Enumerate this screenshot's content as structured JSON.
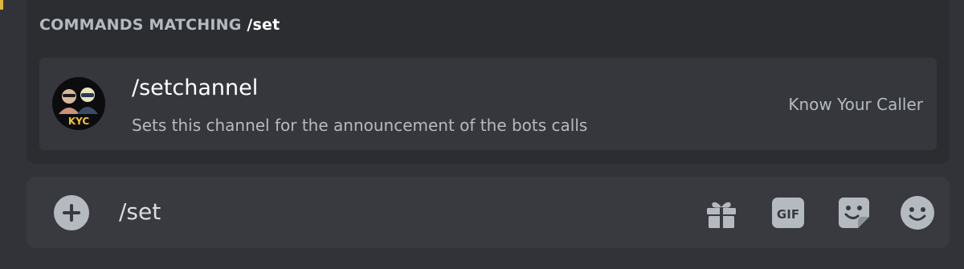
{
  "autocomplete": {
    "header_prefix": "COMMANDS MATCHING",
    "header_query": "/set",
    "command": {
      "name": "/setchannel",
      "description": "Sets this channel for the announcement of the bots calls",
      "source": "Know Your Caller",
      "avatar_text": "KYC"
    }
  },
  "composer": {
    "value": "/set",
    "gif_label": "GIF",
    "icons": [
      "plus-circle-icon",
      "gift-icon",
      "gif-icon",
      "sticker-icon",
      "emoji-icon"
    ]
  },
  "colors": {
    "background": "#313338",
    "popup": "#2b2d31",
    "row_selected": "#35373c",
    "input": "#383a40",
    "muted_text": "#b5bac1",
    "accent": "#e4b33a"
  }
}
